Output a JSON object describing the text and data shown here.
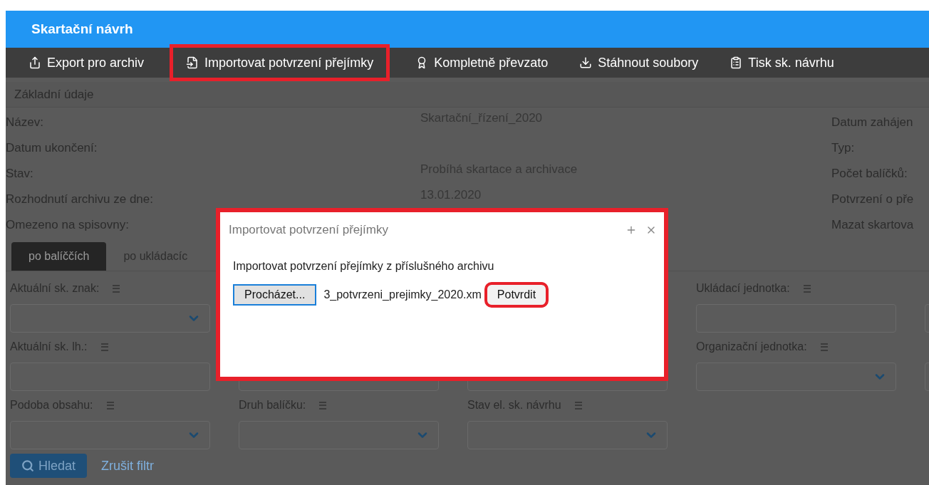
{
  "header": {
    "title": "Skartační návrh"
  },
  "toolbar": [
    {
      "kind": "export",
      "label": "Export pro archiv",
      "highlighted": false
    },
    {
      "kind": "import",
      "label": "Importovat potvrzení přejímky",
      "highlighted": true
    },
    {
      "kind": "award",
      "label": "Kompletně převzato",
      "highlighted": false
    },
    {
      "kind": "download",
      "label": "Stáhnout soubory",
      "highlighted": false
    },
    {
      "kind": "print",
      "label": "Tisk sk. návrhu",
      "highlighted": false
    }
  ],
  "section": {
    "title": "Základní údaje"
  },
  "details": [
    {
      "label": "Název:",
      "value": "Skartační_řízení_2020",
      "right_label": "Datum zahájen"
    },
    {
      "label": "Datum ukončení:",
      "right_label": "Typ:"
    },
    {
      "label": "Stav:",
      "value": "Probíhá skartace a archivace",
      "right_label": "Počet balíčků:"
    },
    {
      "label": "Rozhodnutí archivu ze dne:",
      "value": "13.01.2020",
      "right_label": "Potvrzení o pře"
    },
    {
      "label": "Omezeno na spisovny:",
      "right_label": "Mazat skartova"
    }
  ],
  "tabs": [
    {
      "label": "po balíččích",
      "selected": true
    },
    {
      "label": "po ukládacíc",
      "selected": false
    }
  ],
  "filter_rows": [
    [
      {
        "kind": "select",
        "label": "Aktuální sk. znak:",
        "menu": true
      },
      {
        "kind": "covered"
      },
      {
        "kind": "covered"
      },
      {
        "kind": "input",
        "label": "Ukládací jednotka:",
        "menu": true
      },
      {
        "kind": "input"
      }
    ],
    [
      {
        "kind": "input",
        "label": "Aktuální sk. lh.:",
        "menu": true
      },
      {
        "kind": "input"
      },
      {
        "kind": "input"
      },
      {
        "kind": "select",
        "label": "Organizační jednotka:",
        "menu": true
      },
      {
        "kind": "input"
      }
    ],
    [
      {
        "kind": "select",
        "label": "Podoba obsahu:",
        "menu": true
      },
      {
        "kind": "select",
        "label": "Druh balíčku:",
        "menu": true
      },
      {
        "kind": "select",
        "label": "Stav el. sk. návrhu",
        "menu": true
      }
    ]
  ],
  "search_button": "Hledat",
  "clear_link": "Zrušit filtr",
  "dialog": {
    "title": "Importovat potvrzení přejímky",
    "highlighted": true,
    "message": "Importovat potvrzení přejímky z příslušného archivu",
    "browse_button": "Procházet...",
    "file_name": "3_potvrzeni_prejimky_2020.xm",
    "confirm": {
      "label": "Potvrdit",
      "highlighted": true
    }
  }
}
